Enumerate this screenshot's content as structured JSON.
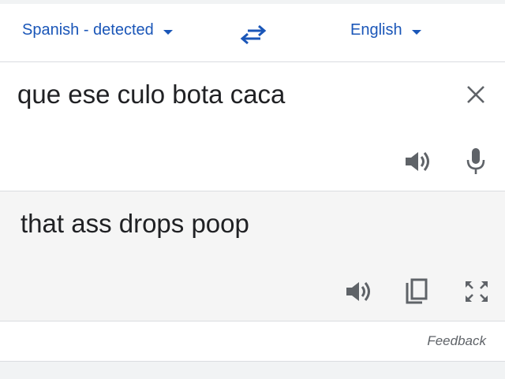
{
  "language_bar": {
    "source_language": "Spanish - detected",
    "target_language": "English",
    "swap_icon": "swap-arrows-icon",
    "dropdown_icon": "caret-down-icon"
  },
  "source_panel": {
    "text": "que ese culo bota caca",
    "clear_icon": "close-icon",
    "listen_icon": "speaker-icon",
    "voice_input_icon": "microphone-icon"
  },
  "target_panel": {
    "text": "that ass drops poop",
    "listen_icon": "speaker-icon",
    "copy_icon": "copy-icon",
    "fullscreen_icon": "fullscreen-icon"
  },
  "footer": {
    "feedback_label": "Feedback"
  },
  "colors": {
    "accent": "#1a56b8",
    "icon": "#5f6368",
    "text": "#202124",
    "divider": "#dadce0",
    "result_background": "#f5f5f5"
  }
}
